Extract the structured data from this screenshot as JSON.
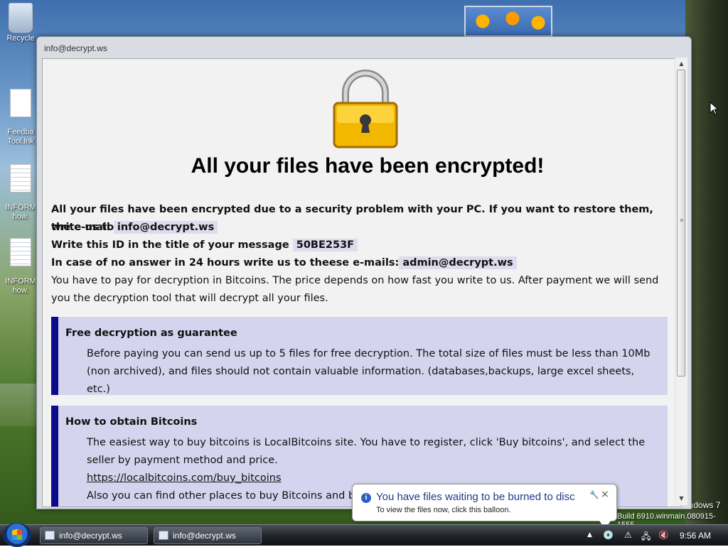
{
  "desktop": {
    "icons": [
      {
        "label": "Recycle",
        "icon": "recycle-bin-icon"
      },
      {
        "label": "Feedba\nTool.lnk",
        "icon": "shortcut-icon"
      },
      {
        "label": "INFORM\nhow.",
        "icon": "text-file-icon"
      },
      {
        "label": "INFORM\nhow.",
        "icon": "text-file-icon"
      }
    ],
    "watermark": {
      "edition": "indows 7",
      "build": "Build 6910.winmain.080915-1555"
    }
  },
  "window": {
    "title": "info@decrypt.ws",
    "heading": "All your files have been encrypted!",
    "intro": {
      "line1": "All your files have been encrypted due to a security problem with your PC. If you want to restore them, write us to",
      "email_prefix": "the e-mail",
      "email": "info@decrypt.ws",
      "id_prefix": "Write this ID in the title of your message",
      "id": "50BE253F",
      "alt_prefix": "In case of no answer in 24 hours write us to theese e-mails:",
      "alt_email": "admin@decrypt.ws",
      "pay_text": "You have to pay for decryption in Bitcoins. The price depends on how fast you write to us. After payment we will send you the decryption tool that will decrypt all your files."
    },
    "panels": [
      {
        "title": "Free decryption as guarantee",
        "body": "Before paying you can send us up to 5 files for free decryption. The total size of files must be less than 10Mb (non archived), and files should not contain valuable information. (databases,backups, large excel sheets, etc.)"
      },
      {
        "title": "How to obtain Bitcoins",
        "body": "The easiest way to buy bitcoins is LocalBitcoins site. You have to register, click 'Buy bitcoins', and select the seller by payment method and price.",
        "link": "https://localbitcoins.com/buy_bitcoins",
        "more": "Also you can find other places to buy Bitcoins and beginne"
      }
    ]
  },
  "balloon": {
    "title": "You have files waiting to be burned to disc",
    "subtitle": "To view the files now, click this balloon."
  },
  "taskbar": {
    "buttons": [
      "info@decrypt.ws",
      "info@decrypt.ws"
    ],
    "clock": "9:56 AM"
  }
}
